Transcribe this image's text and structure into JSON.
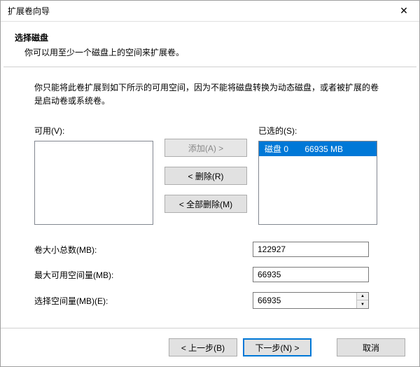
{
  "window": {
    "title": "扩展卷向导",
    "close_icon": "✕"
  },
  "header": {
    "title": "选择磁盘",
    "subtitle": "你可以用至少一个磁盘上的空间来扩展卷。"
  },
  "description": "你只能将此卷扩展到如下所示的可用空间，因为不能将磁盘转换为动态磁盘，或者被扩展的卷是启动卷或系统卷。",
  "lists": {
    "available_label": "可用(V):",
    "available_items": [],
    "selected_label": "已选的(S):",
    "selected_items": [
      {
        "text": "磁盘 0       66935 MB",
        "selected": true
      }
    ]
  },
  "buttons": {
    "add": "添加(A) >",
    "remove": "< 删除(R)",
    "remove_all": "< 全部删除(M)"
  },
  "fields": {
    "total_label": "卷大小总数(MB):",
    "total_value": "122927",
    "max_label": "最大可用空间量(MB):",
    "max_value": "66935",
    "select_label": "选择空间量(MB)(E):",
    "select_value": "66935"
  },
  "footer": {
    "back": "< 上一步(B)",
    "next": "下一步(N) >",
    "cancel": "取消"
  }
}
